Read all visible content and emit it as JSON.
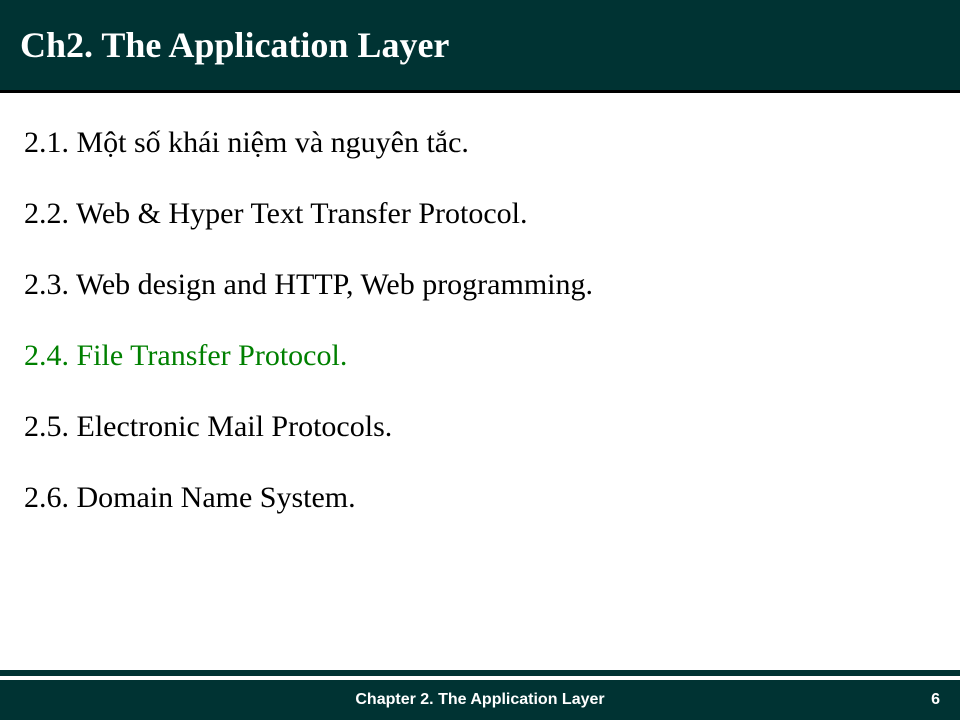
{
  "header": {
    "title": "Ch2. The Application Layer"
  },
  "content": {
    "items": [
      {
        "text": "2.1. Một số khái niệm và nguyên tắc.",
        "highlight": false
      },
      {
        "text": "2.2. Web & Hyper Text Transfer Protocol.",
        "highlight": false
      },
      {
        "text": "2.3. Web design and HTTP, Web programming.",
        "highlight": false
      },
      {
        "text": "2.4. File Transfer Protocol.",
        "highlight": true
      },
      {
        "text": "2.5. Electronic Mail Protocols.",
        "highlight": false
      },
      {
        "text": "2.6. Domain Name System.",
        "highlight": false
      }
    ]
  },
  "footer": {
    "chapter": "Chapter 2. The Application Layer",
    "page": "6"
  }
}
